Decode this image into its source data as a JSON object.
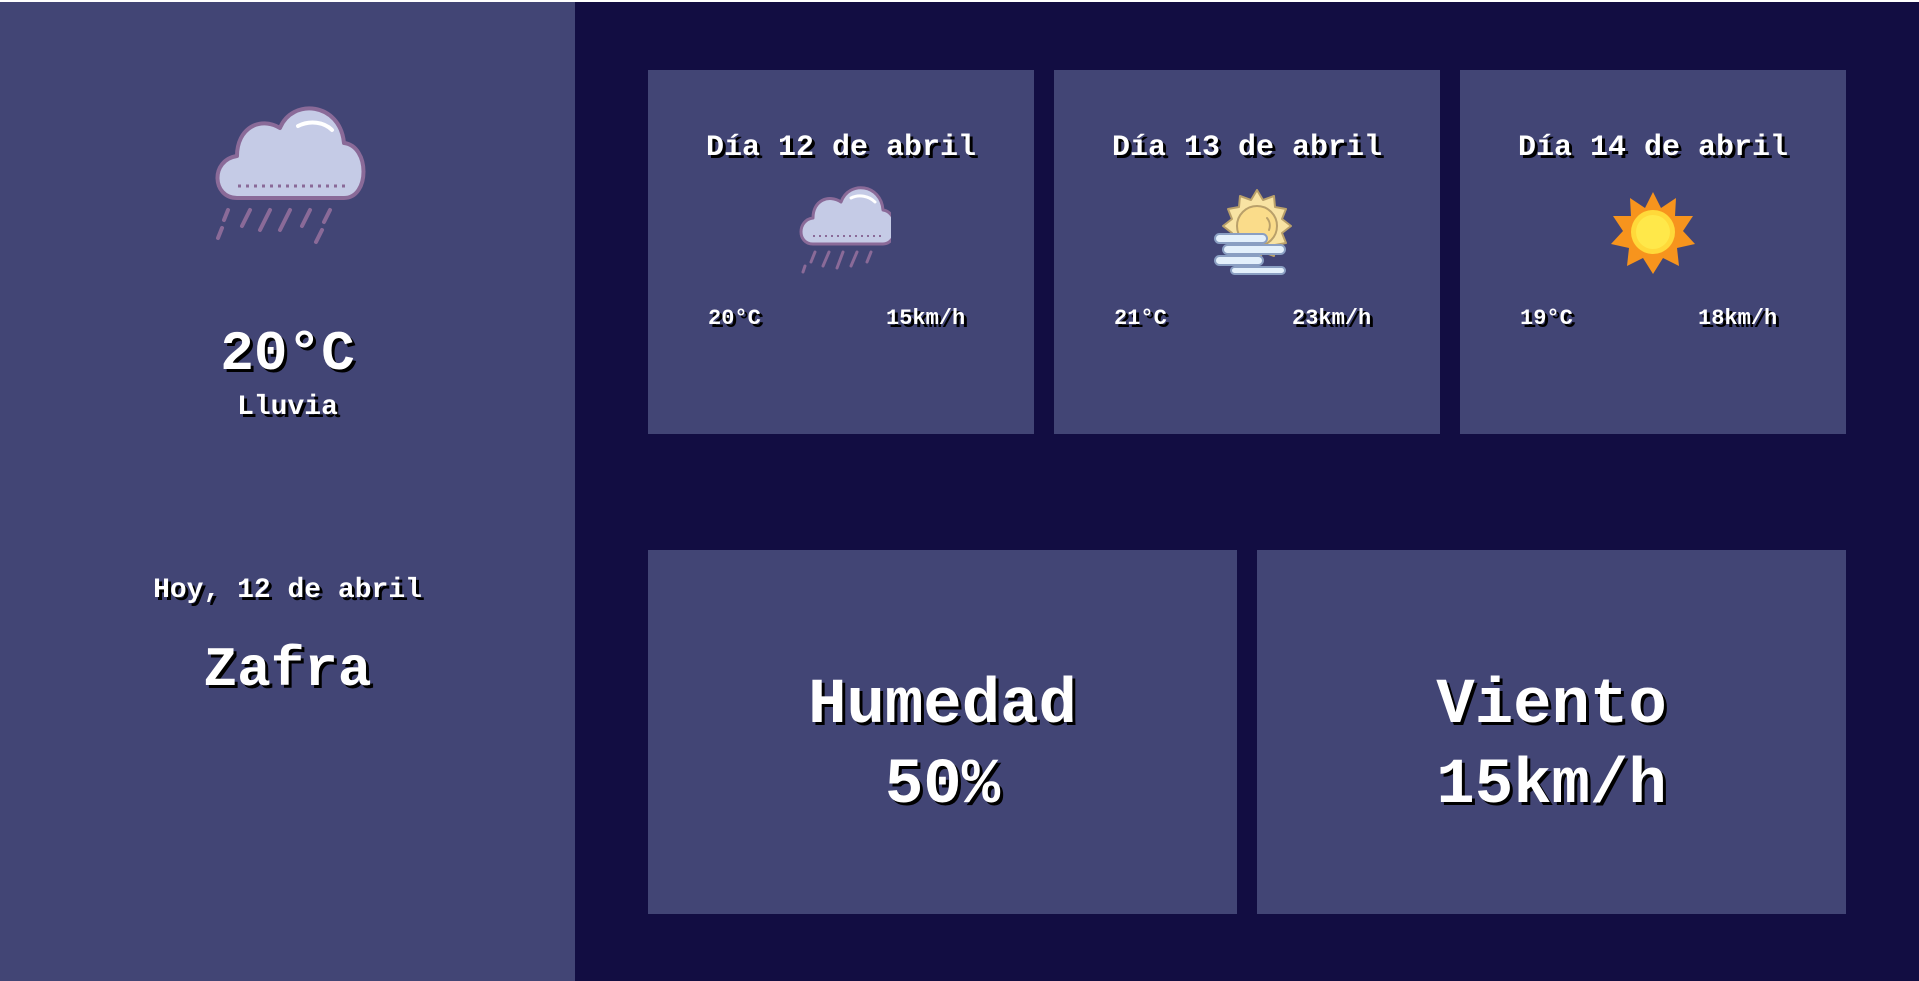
{
  "current": {
    "icon": "rain-cloud-icon",
    "temperature": "20°C",
    "condition": "Lluvia",
    "date": "Hoy, 12 de abril",
    "city": "Zafra"
  },
  "forecast": [
    {
      "title": "Día 12 de abril",
      "icon": "rain-cloud-icon",
      "temperature": "20°C",
      "wind": "15km/h"
    },
    {
      "title": "Día 13 de abril",
      "icon": "sun-fog-icon",
      "temperature": "21°C",
      "wind": "23km/h"
    },
    {
      "title": "Día 14 de abril",
      "icon": "sun-icon",
      "temperature": "19°C",
      "wind": "18km/h"
    }
  ],
  "stats": {
    "humidity": {
      "label": "Humedad",
      "value": "50%"
    },
    "wind": {
      "label": "Viento",
      "value": "15km/h"
    }
  },
  "colors": {
    "background": "#120d42",
    "panel": "#424575",
    "text": "#ffffff",
    "text_shadow": "#000000",
    "cloud": "#c5cbe6",
    "cloud_outline": "#8a6a98",
    "sun": "#ffd93a",
    "sun_rays": "#f7941d"
  }
}
